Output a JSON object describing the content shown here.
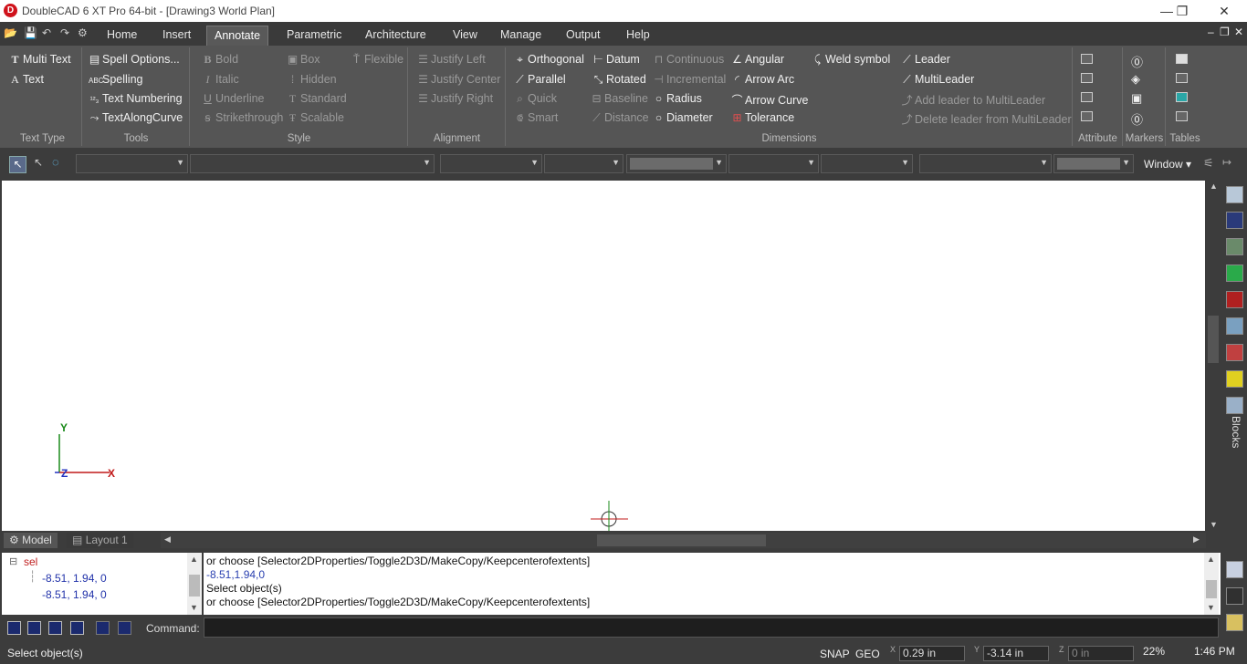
{
  "window": {
    "title": "DoubleCAD 6 XT Pro 64-bit - [Drawing3 World Plan]",
    "minimize": "—",
    "restore": "❐",
    "close": "✕"
  },
  "menu": {
    "tabs": [
      "Home",
      "Insert",
      "Annotate",
      "Parametric",
      "Architecture",
      "View",
      "Manage",
      "Output",
      "Help"
    ],
    "active": "Annotate",
    "mdi_min": "–",
    "mdi_restore": "❐",
    "mdi_close": "✕"
  },
  "ribbon": {
    "text_type": {
      "label": "Text Type",
      "multi_text": "Multi Text",
      "text": "Text"
    },
    "tools": {
      "label": "Tools",
      "spell_options": "Spell Options...",
      "spelling": "Spelling",
      "text_numbering": "Text Numbering",
      "text_along_curve": "TextAlongCurve"
    },
    "style": {
      "label": "Style",
      "bold": "Bold",
      "italic": "Italic",
      "underline": "Underline",
      "strikethrough": "Strikethrough",
      "box": "Box",
      "hidden": "Hidden",
      "standard": "Standard",
      "scalable": "Scalable",
      "flexible": "Flexible"
    },
    "alignment": {
      "label": "Alignment",
      "justify_left": "Justify Left",
      "justify_center": "Justify Center",
      "justify_right": "Justify Right"
    },
    "dimensions": {
      "label": "Dimensions",
      "orthogonal": "Orthogonal",
      "parallel": "Parallel",
      "quick": "Quick",
      "smart": "Smart",
      "datum": "Datum",
      "rotated": "Rotated",
      "baseline": "Baseline",
      "distance": "Distance",
      "continuous": "Continuous",
      "incremental": "Incremental",
      "radius": "Radius",
      "diameter": "Diameter",
      "angular": "Angular",
      "arrow_arc": "Arrow Arc",
      "arrow_curve": "Arrow Curve",
      "tolerance": "Tolerance",
      "weld_symbol": "Weld symbol"
    },
    "leaders": {
      "leader": "Leader",
      "multileader": "MultiLeader",
      "add_leader": "Add leader to MultiLeader",
      "delete_leader": "Delete leader from MultiLeader"
    },
    "attribute": {
      "label": "Attribute"
    },
    "markers": {
      "label": "Markers"
    },
    "tables": {
      "label": "Tables"
    }
  },
  "toolbar2": {
    "window_label": "Window"
  },
  "canvas": {
    "axis_y": "Y",
    "axis_x": "X",
    "axis_z": "Z"
  },
  "layout_tabs": {
    "model": "Model",
    "layout1": "Layout 1"
  },
  "rightbar": {
    "blocks": "Blocks"
  },
  "tree": {
    "root": "sel",
    "items": [
      "-8.51, 1.94, 0",
      "-8.51, 1.94, 0"
    ]
  },
  "command_output": [
    "  or choose [Selector2DProperties/Toggle2D3D/MakeCopy/Keepcenterofextents]",
    "-8.51,1.94,0",
    "Select object(s)",
    "  or choose [Selector2DProperties/Toggle2D3D/MakeCopy/Keepcenterofextents]"
  ],
  "command": {
    "label": "Command:"
  },
  "status": {
    "prompt": "Select object(s)",
    "snap": "SNAP",
    "geo": "GEO",
    "x_label": "X",
    "x_value": "0.29 in",
    "y_label": "Y",
    "y_value": "-3.14 in",
    "z_label": "Z",
    "z_value": "0 in",
    "zoom": "22%",
    "time": "1:46 PM"
  },
  "colors": {
    "accent": "#d0121b",
    "canvas": "#ffffff",
    "ui_dark": "#3c3c3c",
    "ribbon": "#555555",
    "axis_y": "#1a8a1a",
    "axis_x": "#c01818",
    "axis_z": "#2030c0"
  }
}
